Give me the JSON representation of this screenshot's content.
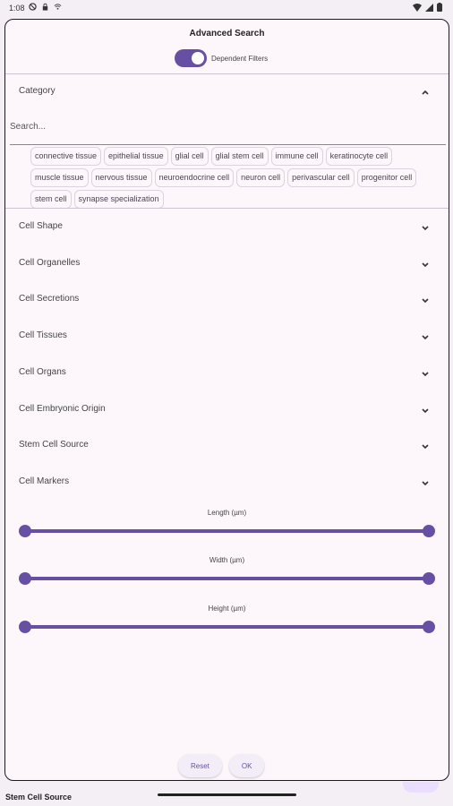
{
  "status": {
    "time": "1:08"
  },
  "dialog": {
    "title": "Advanced Search",
    "toggle_label": "Dependent Filters",
    "category": {
      "label": "Category",
      "search_placeholder": "Search...",
      "chips": [
        "connective tissue",
        "epithelial tissue",
        "glial cell",
        "glial stem cell",
        "immune cell",
        "keratinocyte cell",
        "muscle tissue",
        "nervous tissue",
        "neuroendocrine cell",
        "neuron cell",
        "perivascular cell",
        "progenitor cell",
        "stem cell",
        "synapse specialization"
      ]
    },
    "sections": [
      {
        "label": "Cell Shape"
      },
      {
        "label": "Cell Organelles"
      },
      {
        "label": "Cell Secretions"
      },
      {
        "label": "Cell Tissues"
      },
      {
        "label": "Cell Organs"
      },
      {
        "label": "Cell Embryonic Origin"
      },
      {
        "label": "Stem Cell Source"
      },
      {
        "label": "Cell Markers"
      }
    ],
    "sliders": [
      {
        "label": "Length (µm)"
      },
      {
        "label": "Width (µm)"
      },
      {
        "label": "Height (µm)"
      }
    ],
    "reset_label": "Reset",
    "ok_label": "OK"
  },
  "background": {
    "bottom_label": "Stem Cell Source"
  },
  "colors": {
    "accent": "#6750a4",
    "surface": "#fdf7fc"
  }
}
